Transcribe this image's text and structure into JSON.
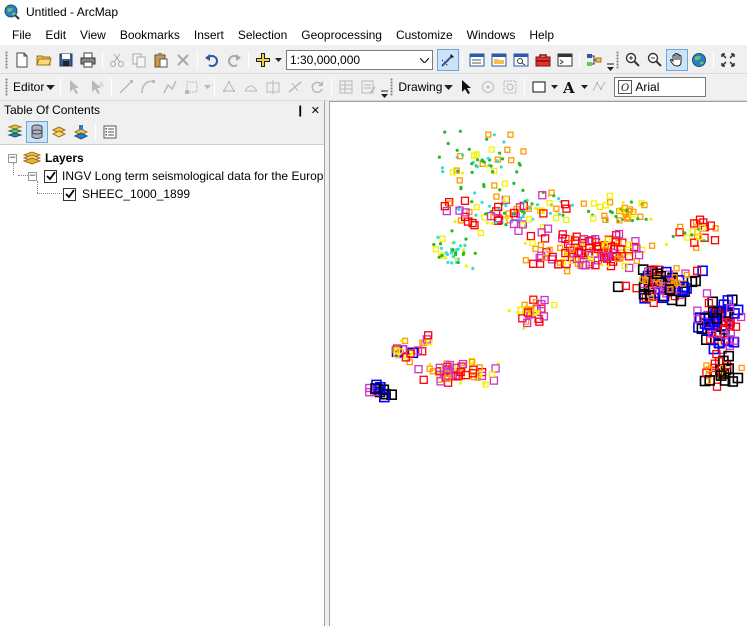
{
  "window": {
    "title": "Untitled - ArcMap"
  },
  "menubar": {
    "items": [
      "File",
      "Edit",
      "View",
      "Bookmarks",
      "Insert",
      "Selection",
      "Geoprocessing",
      "Customize",
      "Windows",
      "Help"
    ]
  },
  "toolbar_standard": {
    "scale_value": "1:30,000,000",
    "icons": [
      "new-document-icon",
      "open-folder-icon",
      "save-icon",
      "print-icon",
      "cut-icon",
      "copy-icon",
      "paste-icon",
      "delete-icon",
      "undo-icon",
      "redo-icon",
      "add-data-icon",
      "editor-toolbar-icon",
      "toc-window-icon",
      "catalog-window-icon",
      "search-window-icon",
      "arctoolbox-icon",
      "python-window-icon",
      "model-builder-icon",
      "zoom-in-icon",
      "zoom-out-icon",
      "pan-hand-icon",
      "full-extent-globe-icon",
      "fixed-zoom-in-icon"
    ]
  },
  "toolbar_editor": {
    "editor_label": "Editor",
    "drawing_label": "Drawing",
    "font_value": "Arial"
  },
  "toc": {
    "title": "Table Of Contents",
    "pin_glyph": "❙",
    "close_glyph": "✕",
    "tools": [
      "list-by-drawing-order-icon",
      "list-by-source-icon",
      "list-by-visibility-icon",
      "list-by-selection-icon",
      "options-icon"
    ],
    "tree": {
      "root_label": "Layers",
      "group_label": "INGV Long term seismological data for the Europ",
      "layer_label": "SHEEC_1000_1899"
    }
  },
  "map": {
    "symbol_colors": {
      "green": "#22bb22",
      "cyan": "#33dddd",
      "yellow": "#f5f200",
      "orange": "#ff9900",
      "red": "#ff0000",
      "magenta": "#cc33cc",
      "blue": "#0000ff",
      "black": "#000000"
    }
  },
  "colors": {
    "selection_accent": "#cde4f7",
    "chrome_bg": "#f0f0f0"
  }
}
